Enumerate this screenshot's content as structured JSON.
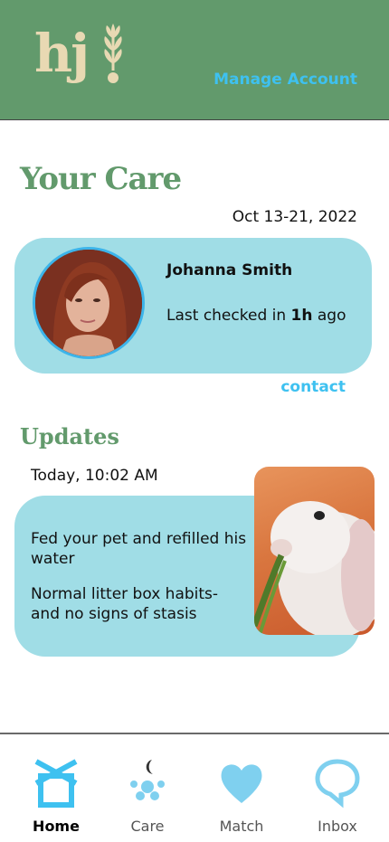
{
  "header": {
    "logo_text": "hj",
    "manage_account_label": "Manage Account",
    "background_color": "#629a6c"
  },
  "page": {
    "title": "Your Care",
    "date_range": "Oct 13-21, 2022"
  },
  "caregiver": {
    "name": "Johanna Smith",
    "checked_prefix": "Last checked in ",
    "checked_value": "1h",
    "checked_suffix": " ago",
    "contact_label": "contact"
  },
  "updates": {
    "title": "Updates",
    "timestamp": "Today, 10:02 AM",
    "notes": [
      "Fed your pet and refilled his water",
      "Normal litter box habits- and no signs of stasis"
    ]
  },
  "tabs": [
    {
      "label": "Home",
      "icon": "home-icon",
      "active": true
    },
    {
      "label": "Care",
      "icon": "care-icon",
      "active": false
    },
    {
      "label": "Match",
      "icon": "heart-icon",
      "active": false
    },
    {
      "label": "Inbox",
      "icon": "chat-bubble-icon",
      "active": false
    }
  ],
  "colors": {
    "accent": "#3ec1f0",
    "card": "#a0dde6",
    "logo": "#e8d9b3"
  }
}
